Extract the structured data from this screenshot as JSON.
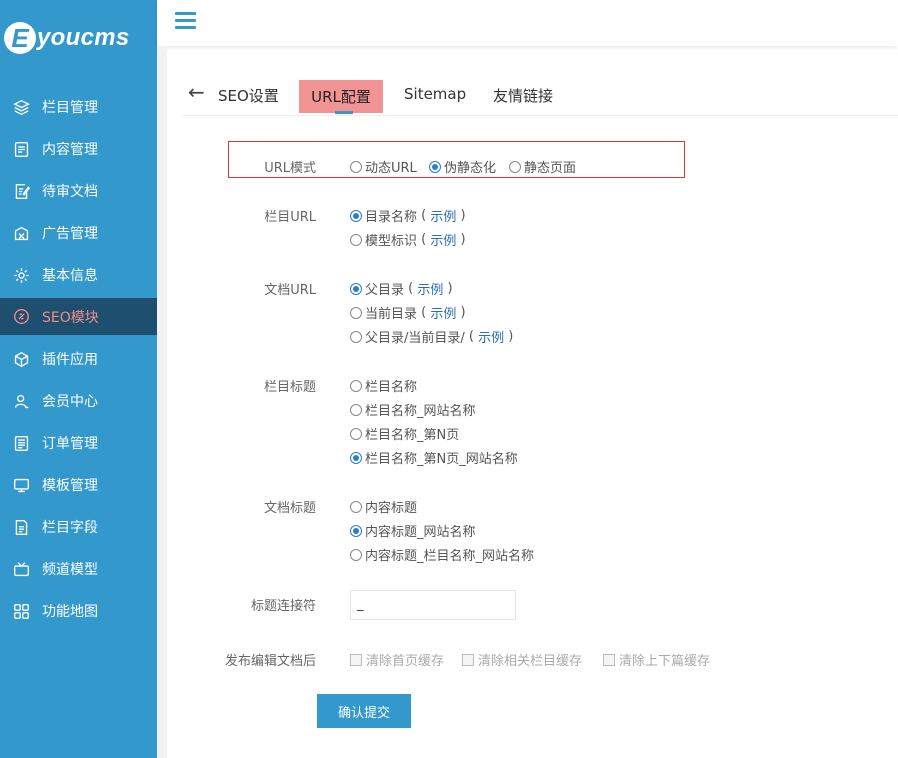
{
  "brand": {
    "logo_letter": "E",
    "logo_text": "youcms"
  },
  "sidebar": {
    "items": [
      {
        "label": "栏目管理",
        "icon": "layers-icon"
      },
      {
        "label": "内容管理",
        "icon": "document-icon"
      },
      {
        "label": "待审文档",
        "icon": "edit-doc-icon"
      },
      {
        "label": "广告管理",
        "icon": "ad-icon"
      },
      {
        "label": "基本信息",
        "icon": "gear-icon"
      },
      {
        "label": "SEO模块",
        "icon": "seo-icon",
        "active": true
      },
      {
        "label": "插件应用",
        "icon": "cube-icon"
      },
      {
        "label": "会员中心",
        "icon": "user-icon"
      },
      {
        "label": "订单管理",
        "icon": "list-icon"
      },
      {
        "label": "模板管理",
        "icon": "monitor-icon"
      },
      {
        "label": "栏目字段",
        "icon": "form-icon"
      },
      {
        "label": "频道模型",
        "icon": "tv-icon"
      },
      {
        "label": "功能地图",
        "icon": "grid-icon"
      }
    ],
    "active_color": "#f28b8b",
    "bg_color": "#3398cc"
  },
  "tabs": {
    "title": "SEO设置",
    "items": [
      "URL配置",
      "Sitemap",
      "友情链接"
    ],
    "active": "URL配置"
  },
  "form": {
    "url_mode": {
      "label": "URL模式",
      "options": [
        "动态URL",
        "伪静态化",
        "静态页面"
      ],
      "selected": "伪静态化"
    },
    "column_url": {
      "label": "栏目URL",
      "options": [
        "目录名称",
        "模型标识"
      ],
      "selected": "目录名称",
      "example": "示例"
    },
    "doc_url": {
      "label": "文档URL",
      "options": [
        "父目录",
        "当前目录",
        "父目录/当前目录/"
      ],
      "selected": "父目录",
      "example": "示例"
    },
    "column_title": {
      "label": "栏目标题",
      "options": [
        "栏目名称",
        "栏目名称_网站名称",
        "栏目名称_第N页",
        "栏目名称_第N页_网站名称"
      ],
      "selected": "栏目名称_第N页_网站名称"
    },
    "doc_title": {
      "label": "文档标题",
      "options": [
        "内容标题",
        "内容标题_网站名称",
        "内容标题_栏目名称_网站名称"
      ],
      "selected": "内容标题_网站名称"
    },
    "separator": {
      "label": "标题连接符",
      "value": "_"
    },
    "after_publish": {
      "label": "发布编辑文档后",
      "options": [
        "清除首页缓存",
        "清除相关栏目缓存",
        "清除上下篇缓存"
      ]
    },
    "submit_label": "确认提交",
    "paren_open": "(",
    "paren_close": ")"
  }
}
